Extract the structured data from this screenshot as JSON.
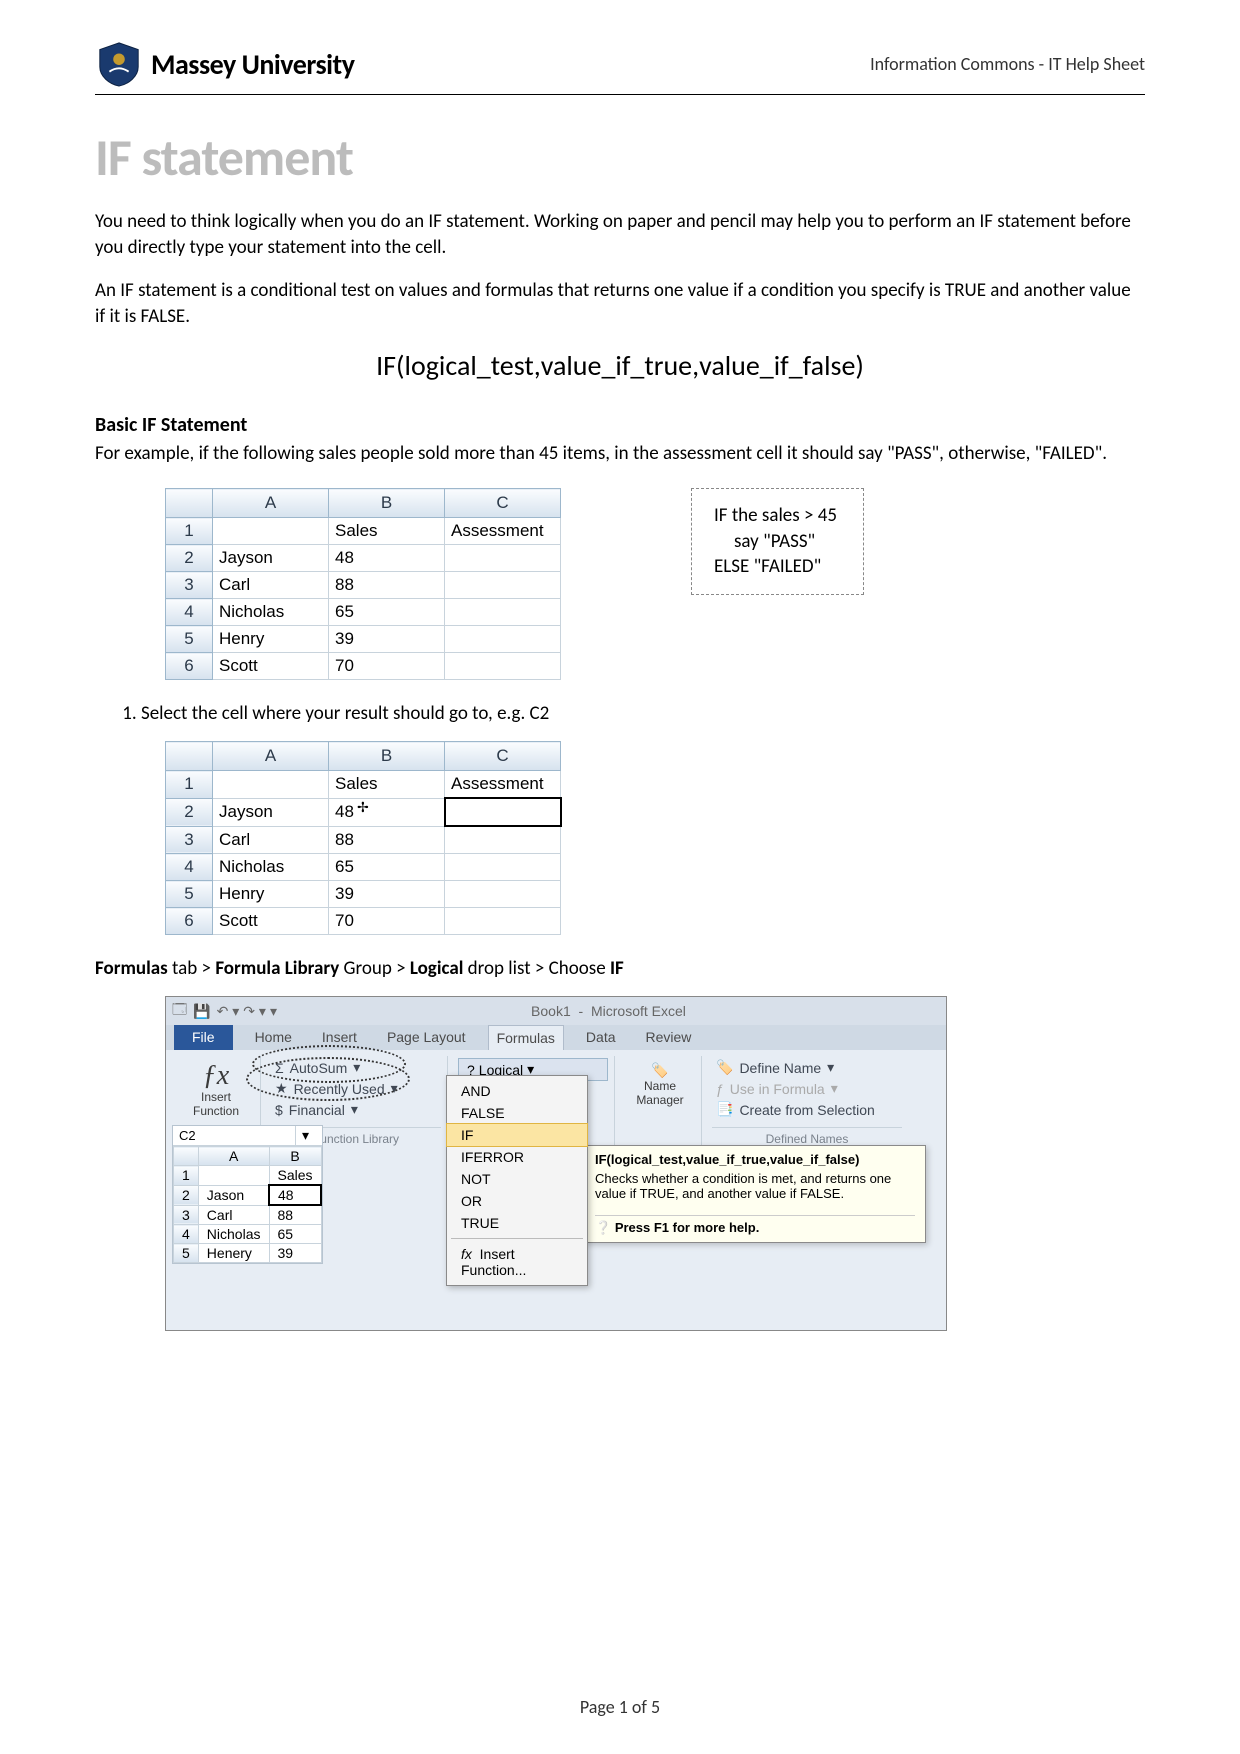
{
  "header": {
    "university": "Massey University",
    "doc_section": "Information Commons - IT Help Sheet"
  },
  "title": "IF statement",
  "intro": [
    "You need to think logically when you do an IF statement.  Working on paper and pencil may help you to perform an IF statement before you directly type your statement into the cell.",
    "An IF statement is a conditional test on values and formulas that returns one value if a condition you specify is TRUE and another value if it is FALSE."
  ],
  "syntax": "IF(logical_test,value_if_true,value_if_false)",
  "basic": {
    "heading": "Basic IF Statement",
    "text": "For example, if the following sales people sold more than 45 items, in the assessment cell it should say \"PASS\", otherwise, \"FAILED\"."
  },
  "table": {
    "cols": [
      "A",
      "B",
      "C"
    ],
    "head": [
      "",
      "Sales",
      "Assessment"
    ],
    "rows": [
      {
        "n": "2",
        "a": "Jayson",
        "b": "48",
        "c": ""
      },
      {
        "n": "3",
        "a": "Carl",
        "b": "88",
        "c": ""
      },
      {
        "n": "4",
        "a": "Nicholas",
        "b": "65",
        "c": ""
      },
      {
        "n": "5",
        "a": "Henry",
        "b": "39",
        "c": ""
      },
      {
        "n": "6",
        "a": "Scott",
        "b": "70",
        "c": ""
      }
    ]
  },
  "callout": {
    "line1": "IF the sales > 45",
    "line2": "say \"PASS\"",
    "line3": "ELSE \"FAILED\""
  },
  "step": "Select the cell where your result should go to, e.g. C2",
  "breadcrumb": {
    "p1": "Formulas",
    "p2": " tab > ",
    "p3": "Formula Library",
    "p4": " Group >  ",
    "p5": "Logical",
    "p6": " drop list > Choose ",
    "p7": "IF"
  },
  "ribbon": {
    "app": "Microsoft Excel",
    "book": "Book1",
    "tabs": [
      "File",
      "Home",
      "Insert",
      "Page Layout",
      "Formulas",
      "Data",
      "Review"
    ],
    "insert_fn_label": "Insert\nFunction",
    "fn_lib": {
      "autosum": "AutoSum",
      "recent": "Recently Used",
      "financial": "Financial",
      "logical": "Logical",
      "group_label": "Function Library"
    },
    "defined": {
      "name_mgr_top": "Name",
      "name_mgr_bottom": "Manager",
      "define": "Define Name",
      "use": "Use in Formula",
      "create": "Create from Selection",
      "group_label": "Defined Names"
    },
    "dropdown": [
      "AND",
      "FALSE",
      "IF",
      "IFERROR",
      "NOT",
      "OR",
      "TRUE",
      "Insert Function..."
    ],
    "tooltip_title": "IF(logical_test,value_if_true,value_if_false)",
    "tooltip_body": "Checks whether a condition is met, and returns one value if TRUE, and another value if FALSE.",
    "tooltip_help": "Press F1 for more help.",
    "namebox": "C2",
    "sheet_cols": [
      "A",
      "B"
    ],
    "sheet_head": [
      "",
      "Sales"
    ],
    "sheet_rows": [
      {
        "n": "2",
        "a": "Jason",
        "b": "48"
      },
      {
        "n": "3",
        "a": "Carl",
        "b": "88"
      },
      {
        "n": "4",
        "a": "Nicholas",
        "b": "65"
      },
      {
        "n": "5",
        "a": "Henery",
        "b": "39"
      }
    ],
    "fx_label": "fx"
  },
  "footer": "Page 1 of 5"
}
